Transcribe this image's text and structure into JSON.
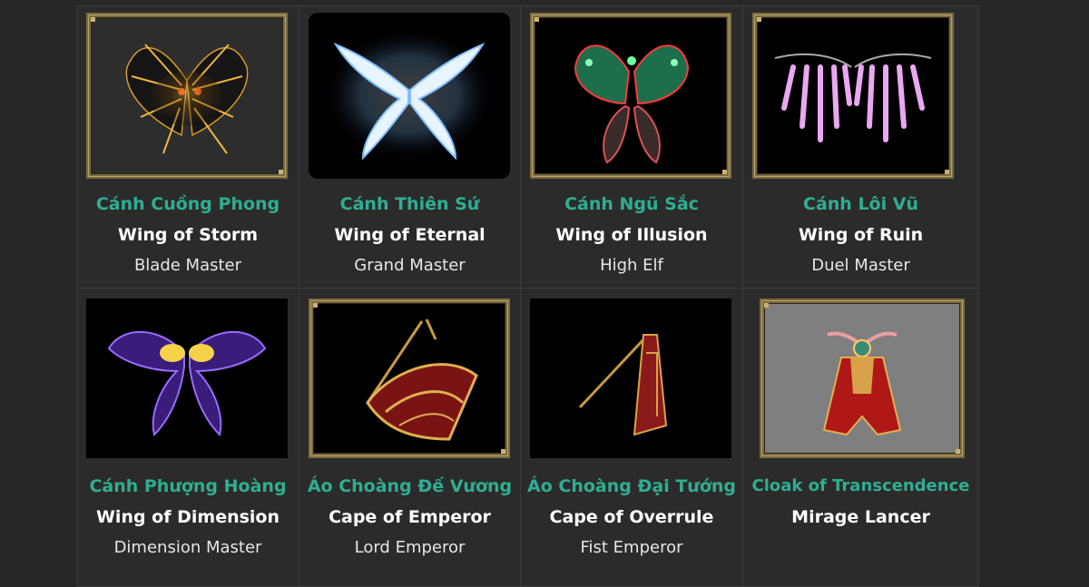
{
  "items": [
    {
      "vn": "Cánh Cuồng Phong",
      "en": "Wing of Storm",
      "class": "Blade Master",
      "image": "dark-gold-wings"
    },
    {
      "vn": "Cánh Thiên Sứ",
      "en": "Wing of Eternal",
      "class": "Grand Master",
      "image": "white-blue-wings"
    },
    {
      "vn": "Cánh Ngũ Sắc",
      "en": "Wing of Illusion",
      "class": "High Elf",
      "image": "green-red-butterfly-wings"
    },
    {
      "vn": "Cánh Lôi Vũ",
      "en": "Wing of Ruin",
      "class": "Duel Master",
      "image": "pink-spiked-wings"
    },
    {
      "vn": "Cánh Phượng Hoàng",
      "en": "Wing of Dimension",
      "class": "Dimension Master",
      "image": "purple-gold-wings"
    },
    {
      "vn": "Áo Choàng Đế Vương",
      "en": "Cape of Emperor",
      "class": "Lord Emperor",
      "image": "red-gold-cape"
    },
    {
      "vn": "Áo Choàng Đại Tướng",
      "en": "Cape of Overrule",
      "class": "Fist Emperor",
      "image": "red-cape-with-staff"
    },
    {
      "vn": "Cloak of Transcendence",
      "en": "Mirage Lancer",
      "class": "",
      "image": "red-cloak-with-wings"
    }
  ],
  "colors": {
    "background": "#262626",
    "cell": "#2b2b2b",
    "vn_name": "#2fae92",
    "en_name": "#ffffff",
    "class_name": "#e6e6e6",
    "frame_gold": "#7a6a3e"
  }
}
